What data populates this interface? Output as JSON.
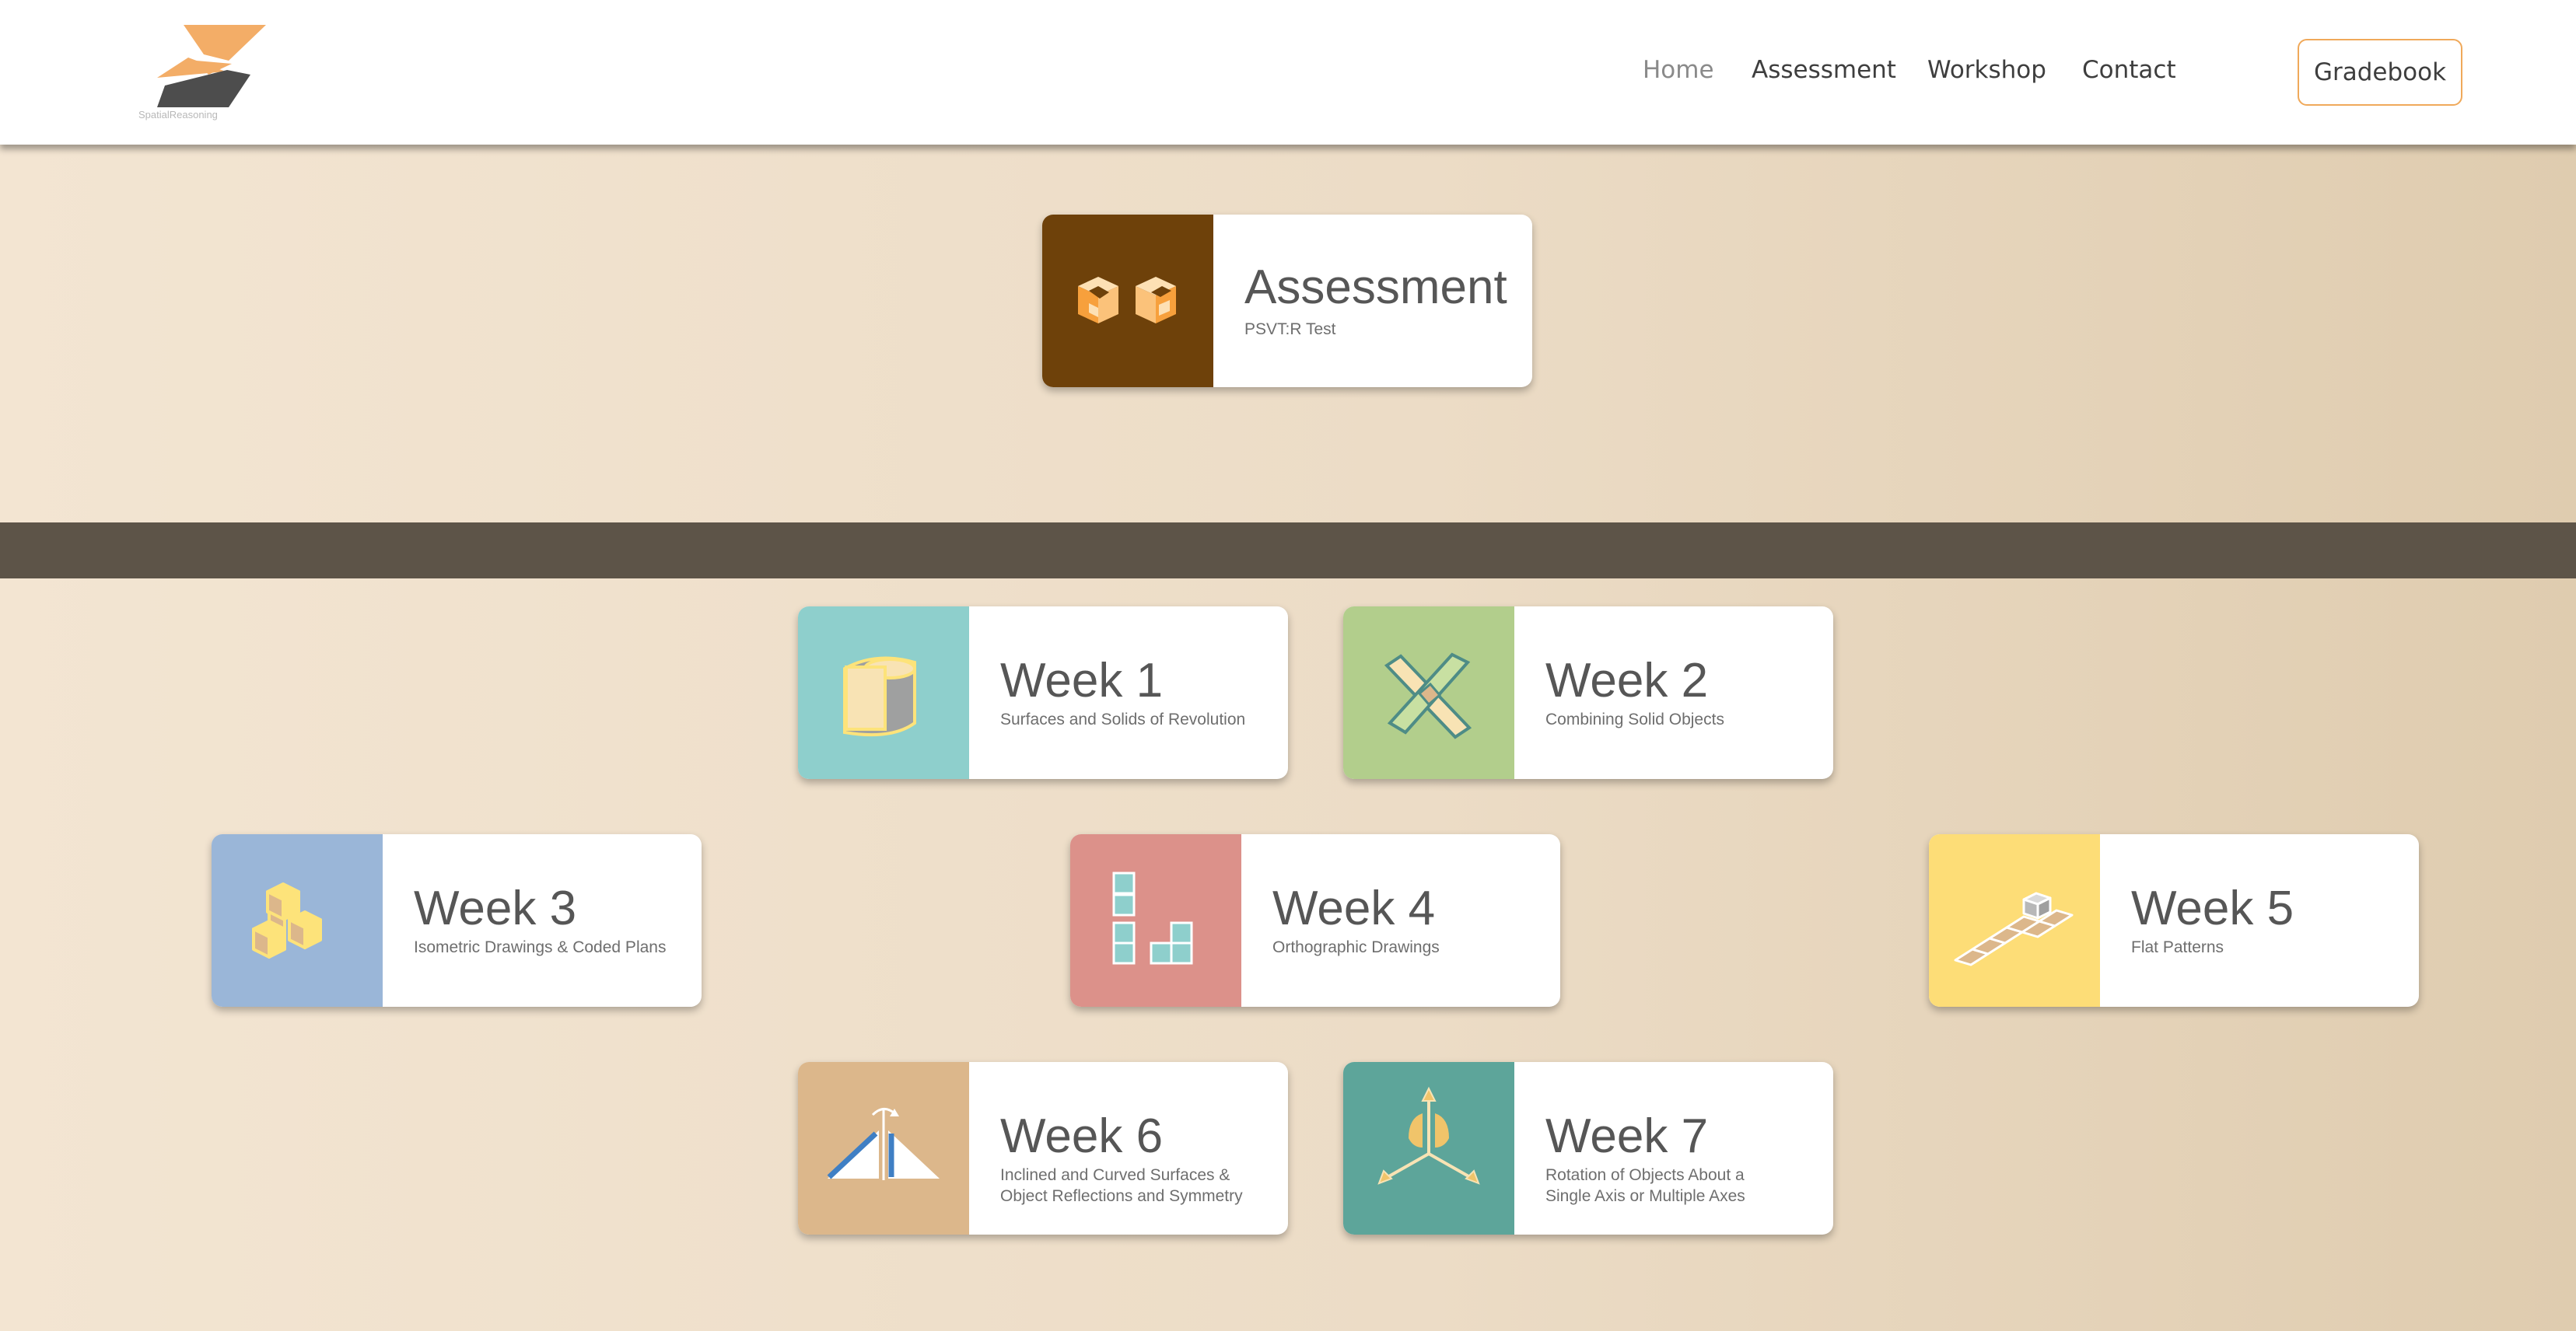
{
  "header": {
    "logo_text": "SpatialReasoning",
    "nav": [
      {
        "label": "Home"
      },
      {
        "label": "Assessment"
      },
      {
        "label": "Workshop"
      },
      {
        "label": "Contact"
      }
    ],
    "gradebook_label": "Gradebook"
  },
  "colors": {
    "accent": "#f0a95a",
    "band": "#5d5448",
    "assessment_tile": "#6e410a",
    "week1_tile": "#8ecfcc",
    "week2_tile": "#b2ce8c",
    "week3_tile": "#9ab6d8",
    "week4_tile": "#dc918a",
    "week5_tile": "#fddd77",
    "week6_tile": "#dcb78b",
    "week7_tile": "#5da59a"
  },
  "assessment": {
    "title": "Assessment",
    "subtitle": "PSVT:R Test",
    "icon": "cubes-icon"
  },
  "weeks": [
    {
      "title": "Week 1",
      "subtitle": "Surfaces and Solids of Revolution",
      "icon": "cylinder-icon"
    },
    {
      "title": "Week 2",
      "subtitle": "Combining Solid Objects",
      "icon": "crossed-prisms-icon"
    },
    {
      "title": "Week 3",
      "subtitle": "Isometric Drawings & Coded Plans",
      "icon": "stacked-cubes-icon"
    },
    {
      "title": "Week 4",
      "subtitle": "Orthographic Drawings",
      "icon": "orthographic-blocks-icon"
    },
    {
      "title": "Week 5",
      "subtitle": "Flat Patterns",
      "icon": "flat-pattern-icon"
    },
    {
      "title": "Week 6",
      "subtitle": "Inclined and Curved Surfaces & Object Reflections and Symmetry",
      "icon": "reflection-icon"
    },
    {
      "title": "Week 7",
      "subtitle": "Rotation of Objects About a Single Axis or Multiple Axes",
      "icon": "rotation-axes-icon"
    }
  ]
}
